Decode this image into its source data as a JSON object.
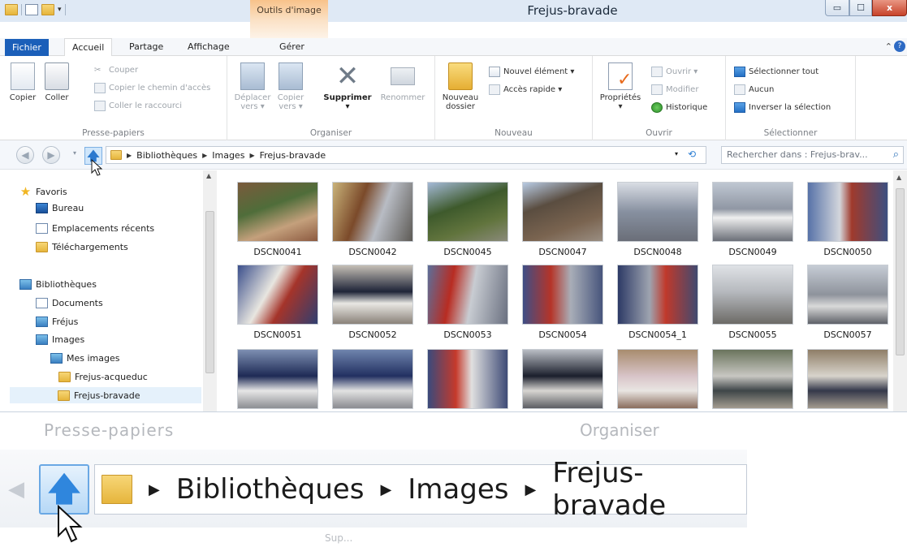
{
  "window": {
    "title": "Frejus-bravade",
    "context_tab_group": "Outils d'image",
    "controls": {
      "minimize": "▭",
      "maximize": "☐",
      "close": "x"
    }
  },
  "tabs": [
    "Fichier",
    "Accueil",
    "Partage",
    "Affichage",
    "Gérer"
  ],
  "ribbon": {
    "presse_papiers": {
      "label": "Presse-papiers",
      "copier": "Copier",
      "coller": "Coller",
      "couper": "Couper",
      "copier_chemin": "Copier le chemin d'accès",
      "coller_raccourci": "Coller le raccourci"
    },
    "organiser": {
      "label": "Organiser",
      "deplacer": "Déplacer",
      "deplacer_sub": "vers ▾",
      "copier_vers": "Copier",
      "copier_vers_sub": "vers ▾",
      "supprimer": "Supprimer",
      "supprimer_sub": "▾",
      "renommer": "Renommer"
    },
    "nouveau": {
      "label": "Nouveau",
      "nouveau_dossier": "Nouveau",
      "nouveau_dossier_sub": "dossier",
      "nouvel_element": "Nouvel élément ▾",
      "acces_rapide": "Accès rapide ▾"
    },
    "ouvrir": {
      "label": "Ouvrir",
      "proprietes": "Propriétés",
      "proprietes_sub": "▾",
      "ouvrir": "Ouvrir ▾",
      "modifier": "Modifier",
      "historique": "Historique"
    },
    "selectionner": {
      "label": "Sélectionner",
      "tout": "Sélectionner tout",
      "aucun": "Aucun",
      "inverser": "Inverser la sélection"
    }
  },
  "address": {
    "back": "◀",
    "forward": "▶",
    "recent_dropdown": "▾",
    "up": "🡅",
    "crumbs": [
      "Bibliothèques",
      "Images",
      "Frejus-bravade"
    ],
    "separator": "▶",
    "dropdown": "▾",
    "refresh": "⟲",
    "search_placeholder": "Rechercher dans : Frejus-brav...",
    "search_icon": "⌕"
  },
  "navpane": {
    "favoris": "Favoris",
    "bureau": "Bureau",
    "recents": "Emplacements récents",
    "telechargements": "Téléchargements",
    "bibliotheques": "Bibliothèques",
    "documents": "Documents",
    "frejus": "Fréjus",
    "images": "Images",
    "mes_images": "Mes images",
    "acqueduc": "Frejus-acqueduc",
    "bravade": "Frejus-bravade"
  },
  "files": {
    "row1": [
      "DSCN0041",
      "DSCN0042",
      "DSCN0045",
      "DSCN0047",
      "DSCN0048",
      "DSCN0049",
      "DSCN0050"
    ],
    "row2": [
      "DSCN0051",
      "DSCN0052",
      "DSCN0053",
      "DSCN0054",
      "DSCN0054_1",
      "DSCN0055",
      "DSCN0057"
    ]
  },
  "zoom": {
    "ghost_left": "Presse-papiers",
    "ghost_right": "Organiser",
    "back": "◀",
    "up": "🡅",
    "crumbs": [
      "Bibliothèques",
      "Images",
      "Frejus-bravade"
    ],
    "separator": "▶",
    "ghost_bottom": "Sup..."
  }
}
